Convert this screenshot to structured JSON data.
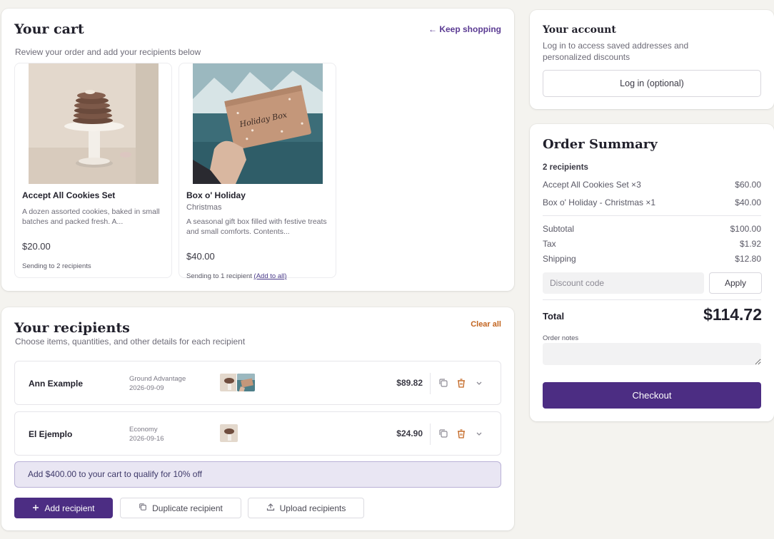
{
  "cart": {
    "title": "Your cart",
    "subtitle": "Review your order and add your recipients below",
    "keep_shopping": "← Keep shopping",
    "products": [
      {
        "name": "Accept All Cookies Set",
        "variant": "",
        "description": "A dozen assorted cookies, baked in small batches and packed fresh. A...",
        "price": "$20.00",
        "sending": "Sending to 2 recipients",
        "add_to_all": ""
      },
      {
        "name": "Box o' Holiday",
        "variant": "Christmas",
        "description": "A seasonal gift box filled with festive treats and small comforts. Contents...",
        "price": "$40.00",
        "sending": "Sending to 1 recipient",
        "add_to_all": "(Add to all)"
      }
    ],
    "box_lettering": "Holiday Box"
  },
  "recipients": {
    "title": "Your recipients",
    "subtitle": "Choose items, quantities, and other details for each recipient",
    "clear_all": "Clear all",
    "rows": [
      {
        "name": "Ann Example",
        "shipping_method": "Ground Advantage",
        "ship_date": "2026-09-09",
        "price": "$89.82"
      },
      {
        "name": "El Ejemplo",
        "shipping_method": "Economy",
        "ship_date": "2026-09-16",
        "price": "$24.90"
      }
    ],
    "promo": "Add $400.00 to your cart to qualify for 10% off",
    "add_recipient": "Add recipient",
    "duplicate_recipient": "Duplicate recipient",
    "upload_recipients": "Upload recipients"
  },
  "account": {
    "title": "Your account",
    "subtitle": "Log in to access saved addresses and personalized discounts",
    "login": "Log in (optional)"
  },
  "summary": {
    "title": "Order Summary",
    "recipient_count": "2 recipients",
    "items": [
      {
        "label": "Accept All Cookies Set ×3",
        "value": "$60.00"
      },
      {
        "label": "Box o' Holiday - Christmas ×1",
        "value": "$40.00"
      }
    ],
    "subtotal_label": "Subtotal",
    "subtotal": "$100.00",
    "tax_label": "Tax",
    "tax": "$1.92",
    "shipping_label": "Shipping",
    "shipping": "$12.80",
    "discount_placeholder": "Discount code",
    "apply": "Apply",
    "total_label": "Total",
    "total": "$114.72",
    "notes_label": "Order notes",
    "checkout": "Checkout"
  },
  "colors": {
    "accent": "#4c2d83",
    "link": "#5b3b93",
    "danger": "#c2641f",
    "promo_bg": "#e9e6f3",
    "background": "#f4f3ef"
  },
  "icons": [
    "arrow-left-icon",
    "copy-icon",
    "trash-icon",
    "chevron-down-icon",
    "plus-icon",
    "duplicate-icon",
    "upload-icon"
  ]
}
